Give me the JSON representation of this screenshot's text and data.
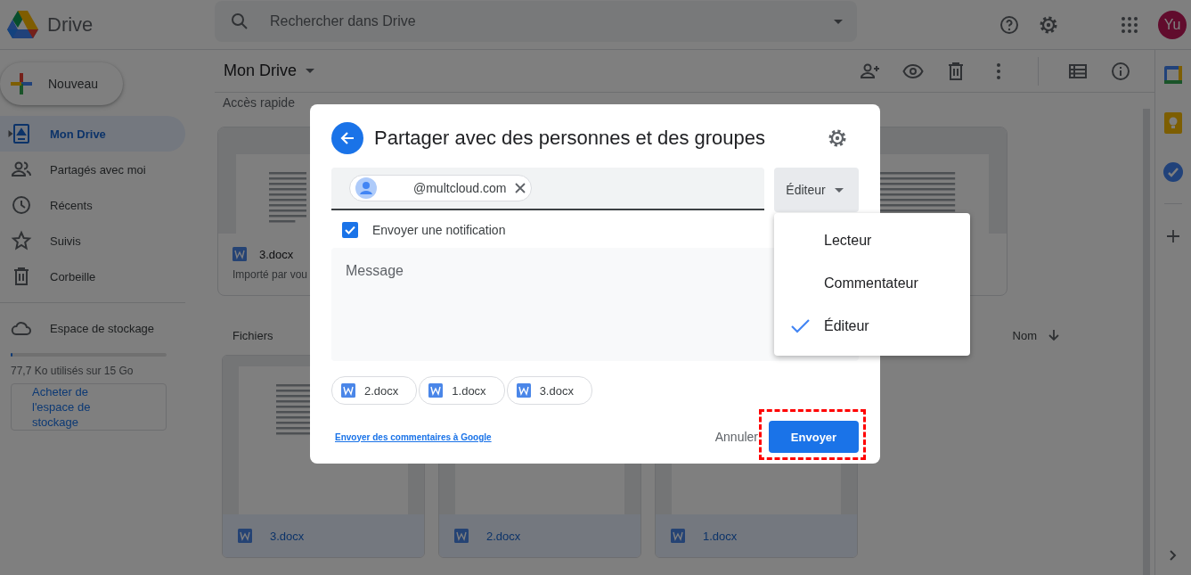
{
  "app": {
    "name": "Drive"
  },
  "search": {
    "placeholder": "Rechercher dans Drive"
  },
  "account": {
    "initials": "Yu"
  },
  "new_button": {
    "label": "Nouveau"
  },
  "sidebar": {
    "items": [
      {
        "label": "Mon Drive",
        "kind": "drive",
        "selected": true
      },
      {
        "label": "Partagés avec moi",
        "kind": "shared",
        "selected": false
      },
      {
        "label": "Récents",
        "kind": "recent",
        "selected": false
      },
      {
        "label": "Suivis",
        "kind": "starred",
        "selected": false
      },
      {
        "label": "Corbeille",
        "kind": "trash",
        "selected": false
      }
    ]
  },
  "storage": {
    "label": "Espace de stockage",
    "level": 0.01,
    "usage": "77,7 Ko utilisés sur 15 Go",
    "buy_button": "Acheter de l'espace de stockage"
  },
  "location": {
    "title": "Mon Drive"
  },
  "quick_access": {
    "title": "Accès rapide",
    "cards": [
      {
        "kind": "full",
        "name": "3.docx",
        "detail": "Importé par vou"
      },
      {
        "kind": "preview"
      }
    ]
  },
  "files": {
    "title": "Fichiers",
    "sort": "Nom",
    "items": [
      {
        "name": "3.docx",
        "selected": true
      },
      {
        "name": "2.docx",
        "selected": true
      },
      {
        "name": "1.docx",
        "selected": true
      }
    ]
  },
  "dialog": {
    "title": "Partager avec des personnes et des groupes",
    "recipients": [
      {
        "email": "@multcloud.com"
      }
    ],
    "role": "Éditeur",
    "notify": {
      "label": "Envoyer une notification",
      "checked": true
    },
    "message": {
      "placeholder": "Message"
    },
    "attachments": [
      "2.docx",
      "1.docx",
      "3.docx"
    ],
    "feedback_link": "Envoyer des commentaires à Google",
    "cancel": "Annuler",
    "send": {
      "label": "Envoyer",
      "highlighted": true
    }
  },
  "role_menu": {
    "items": [
      {
        "label": "Lecteur",
        "selected": false
      },
      {
        "label": "Commentateur",
        "selected": false
      },
      {
        "label": "Éditeur",
        "selected": true
      }
    ]
  }
}
